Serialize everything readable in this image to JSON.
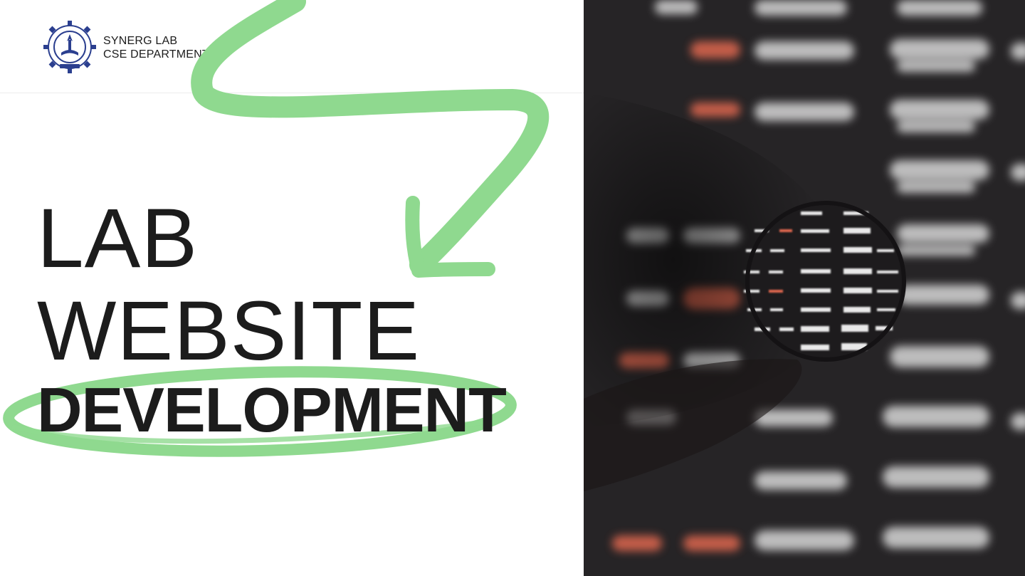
{
  "header": {
    "org_line1": "SYNERG LAB",
    "org_line2": "CSE DEPARTMENT",
    "logo_icon": "institute-seal-icon"
  },
  "title": {
    "line1": "LAB",
    "line2": "WEBSITE",
    "line3": "DEVELOPMENT"
  },
  "colors": {
    "accent_green": "#8fd98f",
    "text": "#1c1c1c",
    "photo_bg": "#262426",
    "highlight_red": "#e0674f"
  },
  "hero_image": {
    "icon": "magnifier-over-screen-photo"
  }
}
